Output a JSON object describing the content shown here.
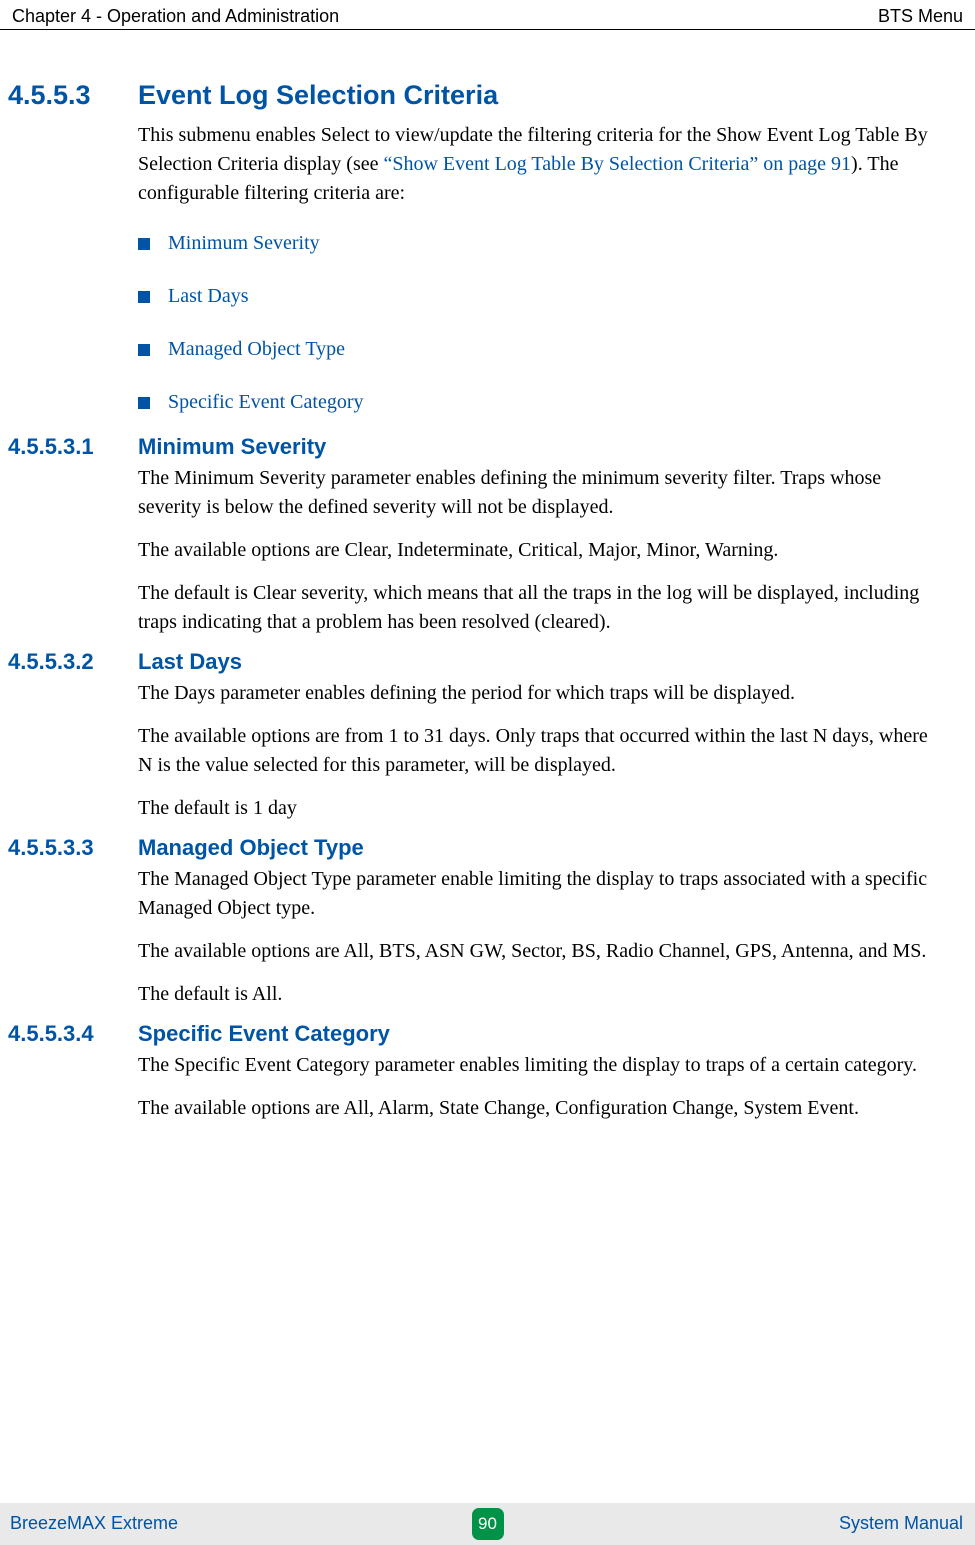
{
  "header": {
    "left": "Chapter 4 - Operation and Administration",
    "right": "BTS Menu"
  },
  "h2": {
    "num": "4.5.5.3",
    "title": "Event Log Selection Criteria"
  },
  "intro": {
    "part1": "This submenu enables Select to view/update the filtering criteria for the Show Event Log Table By Selection Criteria display (see ",
    "link": "“Show Event Log Table By Selection Criteria” on page 91",
    "part2": "). The configurable filtering criteria are:"
  },
  "bullets": [
    "Minimum Severity",
    "Last Days",
    "Managed Object Type",
    "Specific Event Category"
  ],
  "sections": [
    {
      "num": "4.5.5.3.1",
      "title": "Minimum Severity",
      "paras": [
        "The Minimum Severity parameter enables defining the minimum severity filter. Traps whose severity is below the defined severity will not be displayed.",
        "The available options are Clear, Indeterminate, Critical, Major, Minor, Warning.",
        "The default is Clear severity, which means that all the traps in the log will be displayed, including traps indicating that a problem has been resolved (cleared)."
      ]
    },
    {
      "num": "4.5.5.3.2",
      "title": "Last Days",
      "paras": [
        "The Days parameter enables defining the period for which traps will be displayed.",
        "The available options are from 1 to 31 days. Only traps that occurred within the last N days, where N is the value selected for this parameter, will be displayed.",
        "The default is 1 day"
      ]
    },
    {
      "num": "4.5.5.3.3",
      "title": "Managed Object Type",
      "paras": [
        "The Managed Object Type parameter enable limiting the display to traps associated with a specific Managed Object type.",
        "The available options are All, BTS, ASN GW, Sector, BS, Radio Channel, GPS, Antenna, and MS.",
        "The default is All."
      ]
    },
    {
      "num": "4.5.5.3.4",
      "title": "Specific Event Category",
      "paras": [
        "The Specific Event Category parameter enables limiting the display to traps of a certain category.",
        "The available options are All, Alarm, State Change, Configuration Change, System Event."
      ]
    }
  ],
  "footer": {
    "left": "BreezeMAX Extreme",
    "page": "90",
    "right": "System Manual"
  }
}
